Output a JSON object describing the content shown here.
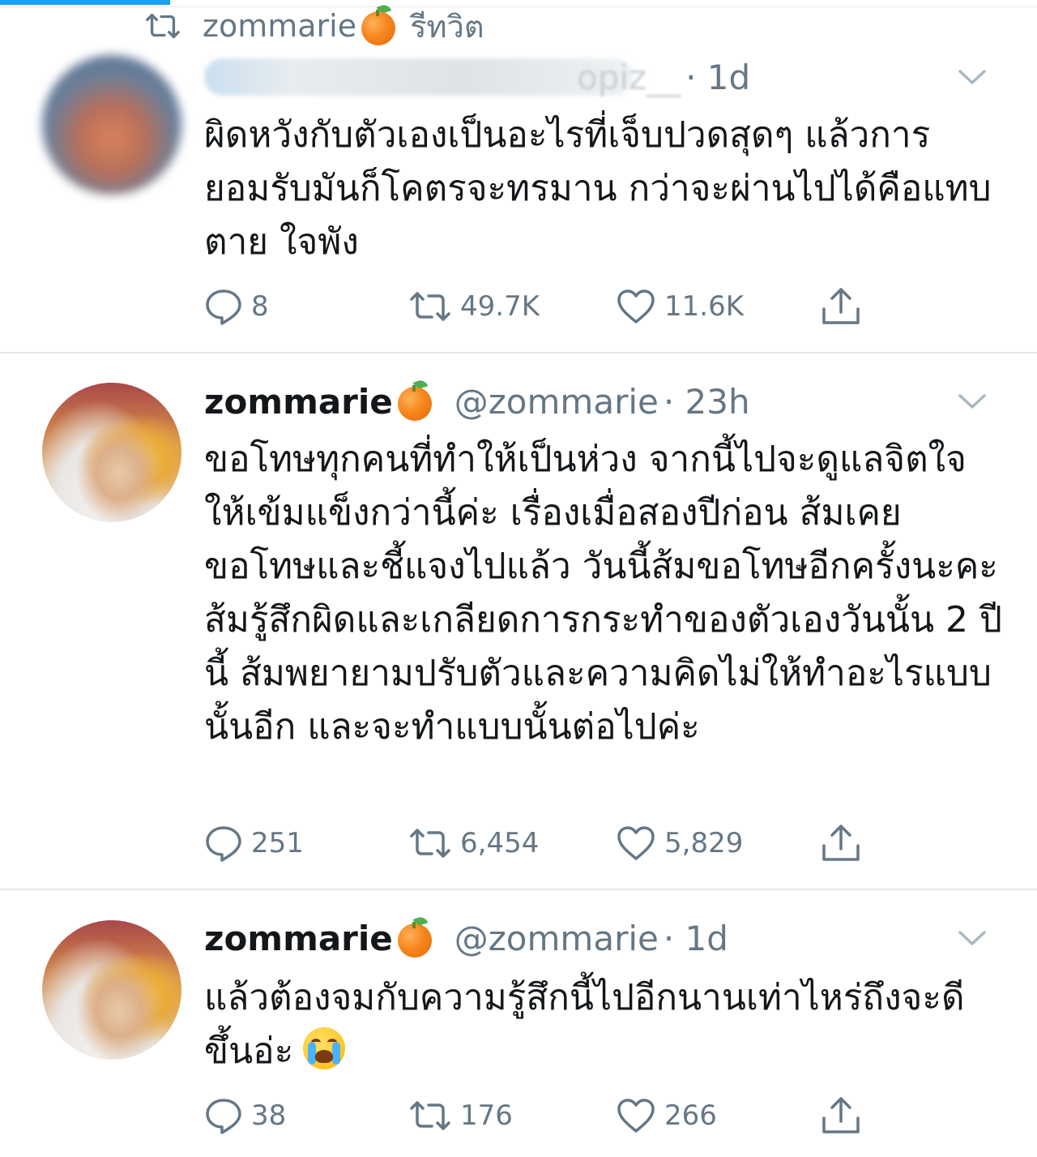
{
  "retweet_context": {
    "user": "zommarie",
    "label": "รีทวิต"
  },
  "tweets": [
    {
      "display_name_tail": "opiz__",
      "time": "· 1d",
      "text": "ผิดหวังกับตัวเองเป็นอะไรที่เจ็บปวดสุดๆ แล้วการยอมรับมันก็โคตรจะทรมาน กว่าจะผ่านไปได้คือแทบตาย ใจพัง",
      "replies": "8",
      "retweets": "49.7K",
      "likes": "11.6K"
    },
    {
      "display_name": "zommarie",
      "handle": "@zommarie",
      "time": "· 23h",
      "text": "ขอโทษทุกคนที่ทำให้เป็นห่วง จากนี้ไปจะดูแลจิตใจให้เข้มแข็งกว่านี้ค่ะ เรื่องเมื่อสองปีก่อน ส้มเคยขอโทษและชี้แจงไปแล้ว วันนี้ส้มขอโทษอีกครั้งนะคะ ส้มรู้สึกผิดและเกลียดการกระทำของตัวเองวันนั้น 2 ปีนี้ ส้มพยายามปรับตัวและความคิดไม่ให้ทำอะไรแบบนั้นอีก และจะทำแบบนั้นต่อไปค่ะ",
      "replies": "251",
      "retweets": "6,454",
      "likes": "5,829"
    },
    {
      "display_name": "zommarie",
      "handle": "@zommarie",
      "time": "· 1d",
      "text": "แล้วต้องจมกับความรู้สึกนี้ไปอีกนานเท่าไหร่ถึงจะดีขึ้นอ่ะ",
      "replies": "38",
      "retweets": "176",
      "likes": "266"
    }
  ],
  "icons": {
    "retweet_context": "retweet-icon",
    "reply": "reply-icon",
    "retweet": "retweet-icon",
    "like": "heart-icon",
    "share": "share-icon",
    "menu": "chevron-down-icon",
    "name_emoji": "tangerine-emoji",
    "text_emoji": "loudly-crying-face-emoji"
  },
  "colors": {
    "accent": "#1da1f2",
    "secondary_text": "#657786",
    "divider": "#e1e8ed"
  }
}
